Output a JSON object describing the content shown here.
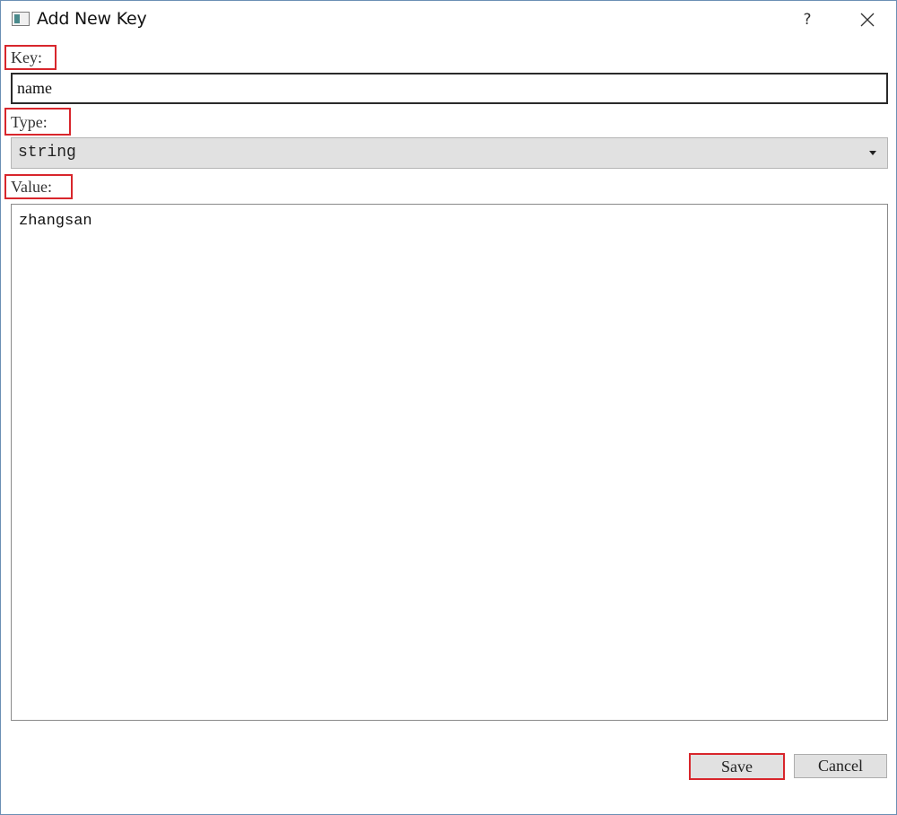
{
  "window": {
    "title": "Add New Key",
    "help_label": "?",
    "icons": {
      "app": "app-window-icon",
      "close": "close-icon"
    }
  },
  "form": {
    "key_label": "Key:",
    "key_value": "name",
    "type_label": "Type:",
    "type_selected": "string",
    "value_label": "Value:",
    "value_text": "zhangsan"
  },
  "buttons": {
    "save_label": "Save",
    "cancel_label": "Cancel"
  },
  "colors": {
    "highlight_border": "#d8262c",
    "button_bg": "#e1e1e1",
    "window_border": "#6b8fb5"
  }
}
